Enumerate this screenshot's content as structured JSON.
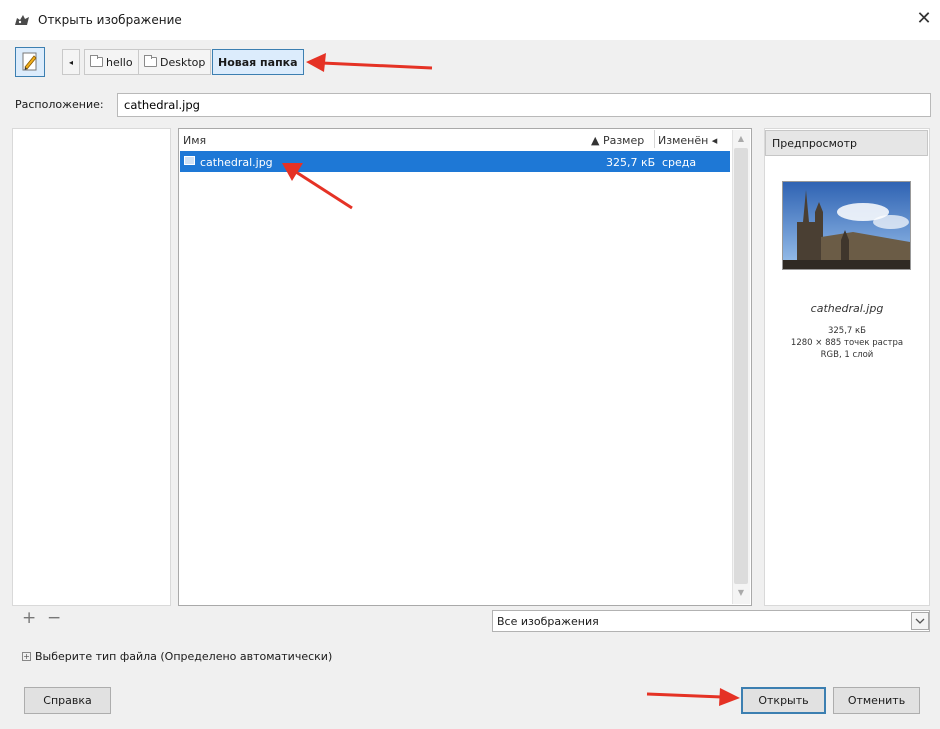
{
  "window": {
    "title": "Открыть изображение",
    "close_glyph": "✕"
  },
  "toolbar": {
    "edit_icon": "pencil-icon",
    "back_glyph": "◂",
    "breadcrumbs": [
      {
        "label": "hello",
        "icon": "folder-icon"
      },
      {
        "label": "Desktop",
        "icon": "folder-icon"
      },
      {
        "label": "Новая папка",
        "active": true
      }
    ]
  },
  "location": {
    "label": "Расположение:",
    "value": "cathedral.jpg"
  },
  "places": {
    "add_glyph": "+",
    "remove_glyph": "−"
  },
  "filelist": {
    "columns": {
      "name": "Имя",
      "size": "▲ Размер",
      "modified": "Изменён ◂"
    },
    "rows": [
      {
        "name": "cathedral.jpg",
        "size": "325,7 кБ",
        "modified": "среда",
        "selected": true,
        "icon": "image-icon"
      }
    ]
  },
  "preview": {
    "button_label": "Предпросмотр",
    "filename": "cathedral.jpg",
    "info": [
      "325,7 кБ",
      "1280 × 885 точек растра",
      "RGB, 1 слой"
    ]
  },
  "filter": {
    "selected": "Все изображения"
  },
  "filetype_toggle": {
    "expander_glyph": "+",
    "label": "Выберите тип файла (Определено автоматически)"
  },
  "buttons": {
    "help": "Справка",
    "open": "Открыть",
    "cancel": "Отменить"
  },
  "colors": {
    "selection": "#1e78d6",
    "arrow": "#e53225",
    "active_crumb": "#dcecfc"
  }
}
